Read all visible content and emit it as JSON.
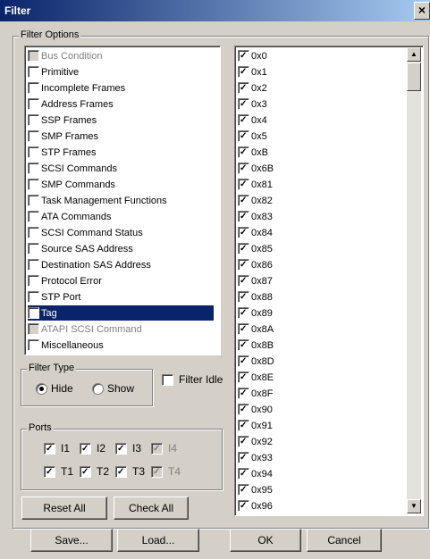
{
  "window": {
    "title": "Filter",
    "close_glyph": "×"
  },
  "filter_options": {
    "label": "Filter Options",
    "items": [
      {
        "label": "Bus Condition",
        "checked": false,
        "disabled": true
      },
      {
        "label": "Primitive",
        "checked": false
      },
      {
        "label": "Incomplete Frames",
        "checked": false
      },
      {
        "label": "Address Frames",
        "checked": false
      },
      {
        "label": "SSP Frames",
        "checked": false
      },
      {
        "label": "SMP Frames",
        "checked": false
      },
      {
        "label": "STP Frames",
        "checked": false
      },
      {
        "label": "SCSI Commands",
        "checked": false
      },
      {
        "label": "SMP Commands",
        "checked": false
      },
      {
        "label": "Task Management Functions",
        "checked": false
      },
      {
        "label": "ATA Commands",
        "checked": false
      },
      {
        "label": "SCSI Command Status",
        "checked": false
      },
      {
        "label": "Source SAS Address",
        "checked": false
      },
      {
        "label": "Destination SAS Address",
        "checked": false
      },
      {
        "label": "Protocol Error",
        "checked": false
      },
      {
        "label": "STP Port",
        "checked": false
      },
      {
        "label": "Tag",
        "checked": true,
        "selected": true
      },
      {
        "label": "ATAPI SCSI Command",
        "checked": false,
        "disabled": true
      },
      {
        "label": "Miscellaneous",
        "checked": false
      }
    ]
  },
  "tags": {
    "items": [
      "0x0",
      "0x1",
      "0x2",
      "0x3",
      "0x4",
      "0x5",
      "0xB",
      "0x6B",
      "0x81",
      "0x82",
      "0x83",
      "0x84",
      "0x85",
      "0x86",
      "0x87",
      "0x88",
      "0x89",
      "0x8A",
      "0x8B",
      "0x8D",
      "0x8E",
      "0x8F",
      "0x90",
      "0x91",
      "0x92",
      "0x93",
      "0x94",
      "0x95",
      "0x96"
    ]
  },
  "filter_type": {
    "label": "Filter Type",
    "hide_label": "Hide",
    "show_label": "Show",
    "selected": "Hide"
  },
  "filter_idle": {
    "label": "Filter Idle",
    "checked": false
  },
  "ports": {
    "label": "Ports",
    "items": [
      {
        "label": "I1",
        "checked": true
      },
      {
        "label": "I2",
        "checked": true
      },
      {
        "label": "I3",
        "checked": true
      },
      {
        "label": "I4",
        "checked": true,
        "disabled": true
      },
      {
        "label": "T1",
        "checked": true
      },
      {
        "label": "T2",
        "checked": true
      },
      {
        "label": "T3",
        "checked": true
      },
      {
        "label": "T4",
        "checked": true,
        "disabled": true
      }
    ]
  },
  "buttons": {
    "reset_all": "Reset All",
    "check_all": "Check All",
    "save": "Save...",
    "load": "Load...",
    "ok": "OK",
    "cancel": "Cancel"
  }
}
